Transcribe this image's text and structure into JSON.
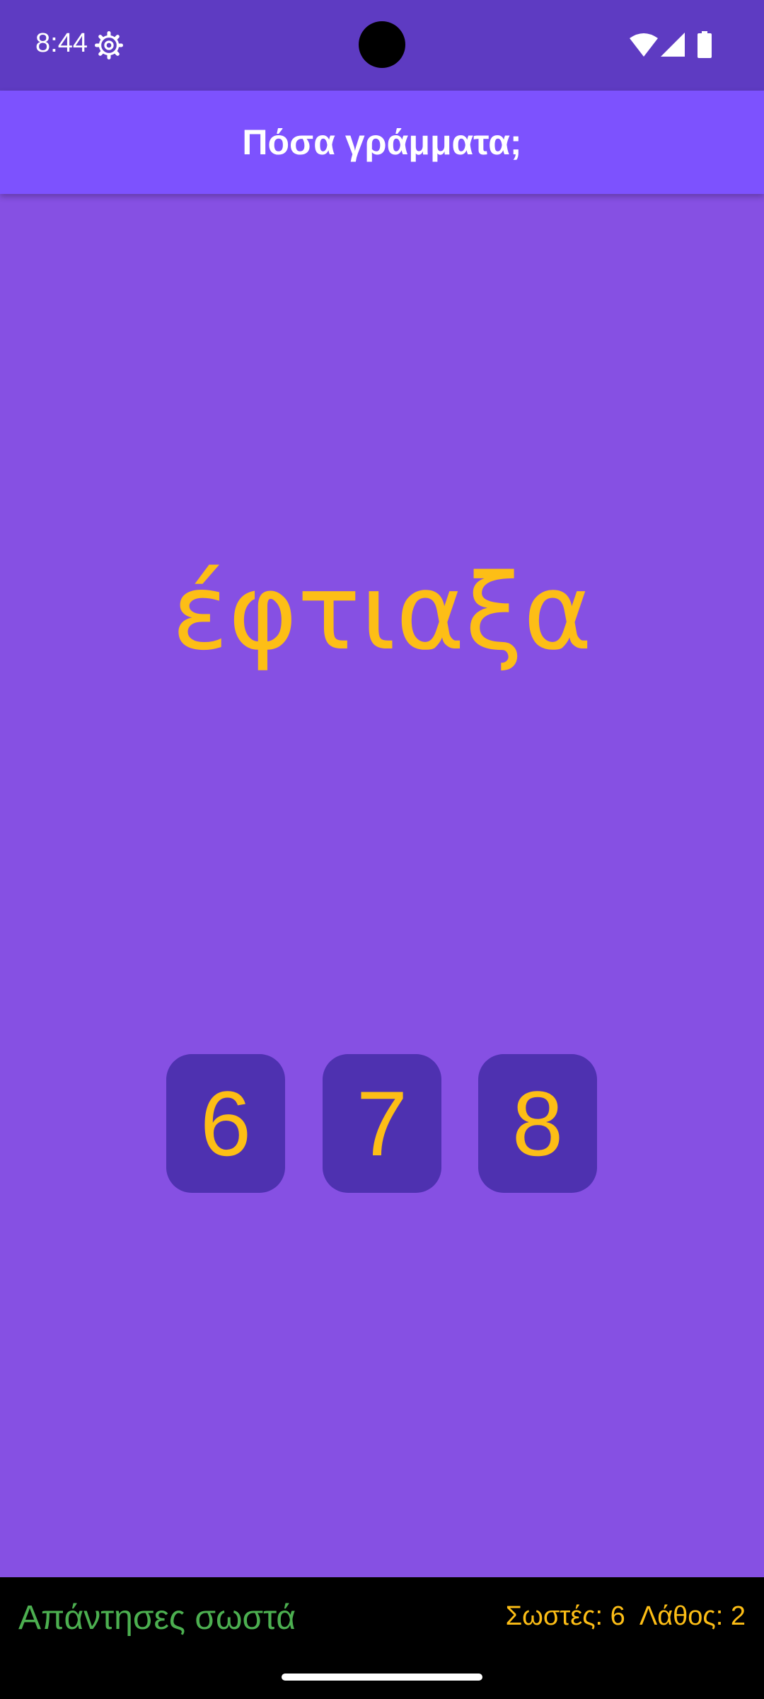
{
  "status_bar": {
    "time": "8:44",
    "icons": [
      "settings-gear-icon",
      "wifi-icon",
      "cell-signal-icon",
      "battery-icon"
    ]
  },
  "app_bar": {
    "title": "Πόσα γράμματα;"
  },
  "word": {
    "text": "έφτιαξα"
  },
  "answers": [
    "6",
    "7",
    "8"
  ],
  "footer": {
    "feedback": "Απάντησες σωστά",
    "correct_label": "Σωστές: 6",
    "wrong_label": "Λάθος: 2"
  },
  "colors": {
    "status_bar": "#5E3BC2",
    "app_bar": "#7D52FE",
    "background": "#8650E3",
    "button": "#4E31B0",
    "accent": "#FDBE16",
    "success": "#4CAF50"
  }
}
